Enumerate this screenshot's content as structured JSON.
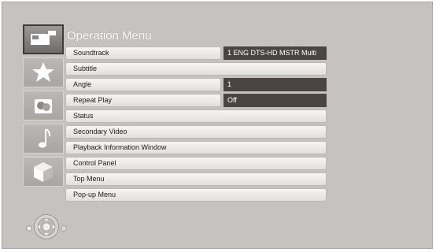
{
  "menu": {
    "title": "Operation Menu",
    "rows": [
      {
        "label": "Soundtrack",
        "value": "1 ENG DTS-HD MSTR Multi"
      },
      {
        "label": "Subtitle"
      },
      {
        "label": "Angle",
        "value": "1"
      },
      {
        "label": "Repeat Play",
        "value": "Off"
      },
      {
        "label": "Status"
      },
      {
        "label": "Secondary Video"
      },
      {
        "label": "Playback Information Window"
      },
      {
        "label": "Control Panel"
      },
      {
        "label": "Top Menu"
      },
      {
        "label": "Pop-up Menu"
      }
    ]
  },
  "sidebar": {
    "tabs": [
      {
        "icon": "video-tab-icon",
        "active": true
      },
      {
        "icon": "star-icon",
        "active": false
      },
      {
        "icon": "photo-icon",
        "active": false
      },
      {
        "icon": "music-note-icon",
        "active": false
      },
      {
        "icon": "cube-icon",
        "active": false
      }
    ]
  },
  "navigation_hint": {
    "icon": "dpad-remote-icon",
    "colors": {
      "panel": "#c6c2c0",
      "value_box": "#4a4543",
      "button": "#efedec"
    }
  }
}
